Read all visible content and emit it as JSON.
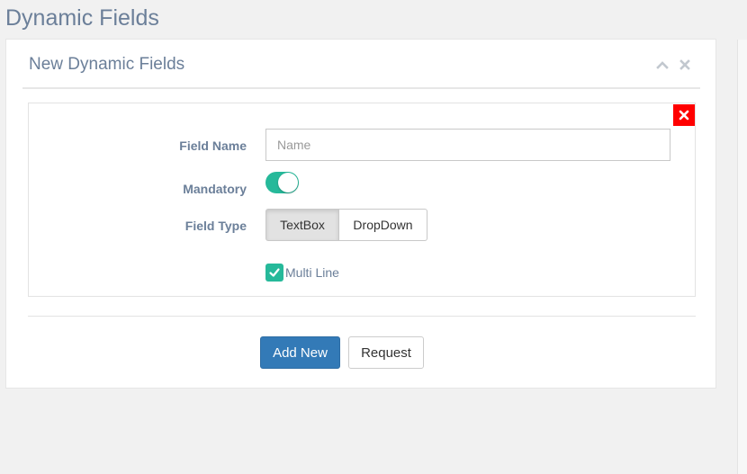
{
  "page": {
    "title": "Dynamic Fields"
  },
  "panel": {
    "title": "New Dynamic Fields",
    "tools": [
      "chevron-up-icon",
      "close-icon"
    ]
  },
  "form": {
    "field_name": {
      "label": "Field Name",
      "placeholder": "Name",
      "value": ""
    },
    "mandatory": {
      "label": "Mandatory",
      "checked": true
    },
    "field_type": {
      "label": "Field Type",
      "options": [
        "TextBox",
        "DropDown"
      ],
      "selected": "TextBox"
    },
    "multi_line": {
      "label": "Multi Line",
      "checked": true
    }
  },
  "actions": {
    "add_new": "Add New",
    "request": "Request"
  },
  "colors": {
    "accent": "#26b99a",
    "primary": "#337ab7",
    "danger": "#ff0000",
    "title_text": "#6b7f99"
  }
}
